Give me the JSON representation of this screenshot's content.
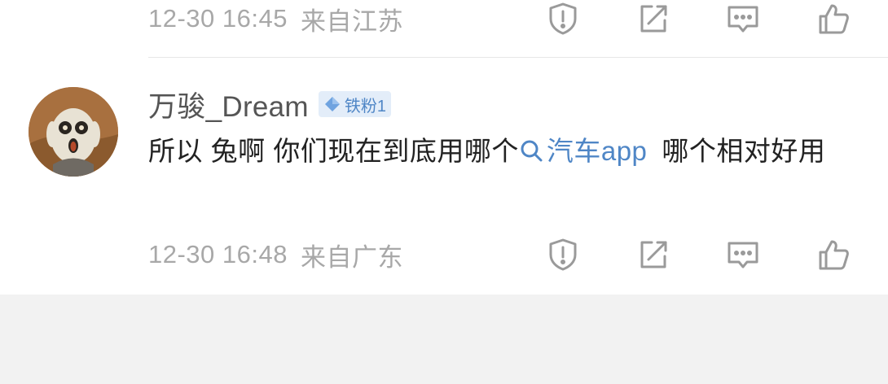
{
  "comments": [
    {
      "time": "12-30 16:45",
      "location": "来自江苏"
    },
    {
      "username": "万骏_Dream",
      "badge": "铁粉1",
      "text_before": "所以 兔啊 你们现在到底用哪个",
      "link_text": "汽车app",
      "text_after": "哪个相对好用",
      "time": "12-30 16:48",
      "location": "来自广东"
    }
  ],
  "icons": {
    "report": "shield-exclamation-icon",
    "share": "edit-share-icon",
    "comment": "comment-bubble-icon",
    "like": "thumbs-up-icon",
    "search": "search-icon",
    "badge": "diamond-icon"
  },
  "colors": {
    "meta_text": "#a8a8a8",
    "body_text": "#222222",
    "link": "#4f86c6",
    "badge_bg": "#e3edf9",
    "page_bg": "#f2f2f2"
  }
}
